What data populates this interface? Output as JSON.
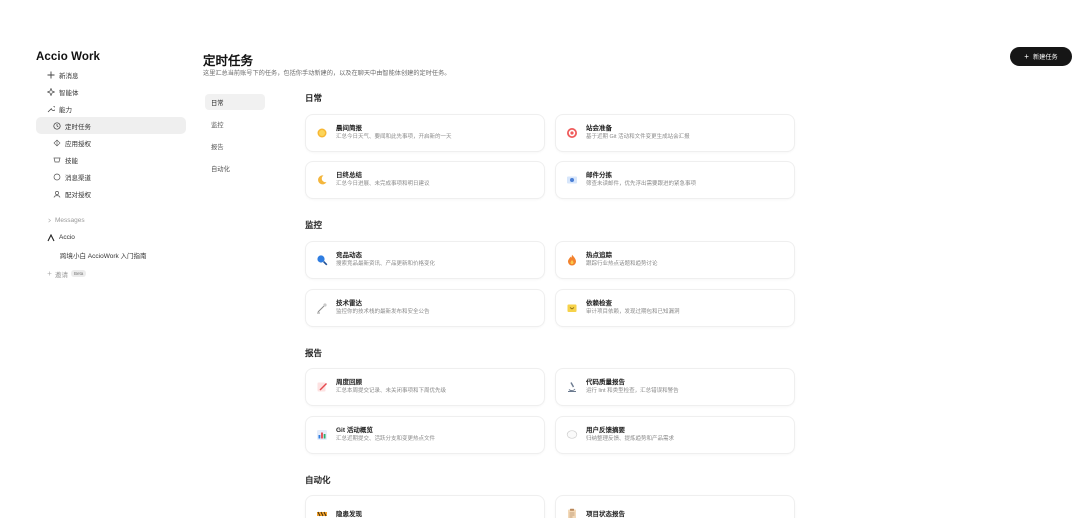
{
  "sidebar": {
    "brand": "Accio Work",
    "items": [
      {
        "label": "新消息",
        "icon": "plus-icon"
      },
      {
        "label": "智能体",
        "icon": "sparkle-icon"
      },
      {
        "label": "能力",
        "icon": "wrench-icon"
      }
    ],
    "sub_items": [
      {
        "label": "定时任务",
        "icon": "clock-icon",
        "active": true
      },
      {
        "label": "应用授权",
        "icon": "link-icon"
      },
      {
        "label": "技能",
        "icon": "skill-icon"
      },
      {
        "label": "消息渠道",
        "icon": "channel-icon"
      },
      {
        "label": "配对授权",
        "icon": "pair-icon"
      }
    ],
    "messages_label": "Messages",
    "accio_label": "Accio",
    "conversation": "跨境小白 AccioWork 入门指南",
    "invite_label": "邀请",
    "beta": "Beta"
  },
  "header": {
    "title": "定时任务",
    "subtitle": "这里汇总当前账号下的任务，包括你手动新建的，以及在聊天中由智能体创建的定时任务。",
    "new_task": "新建任务"
  },
  "categories": [
    "日常",
    "监控",
    "报告",
    "自动化"
  ],
  "sections": {
    "daily": {
      "title": "日常",
      "cards": [
        {
          "title": "晨间简报",
          "desc": "汇总今日天气、要闻和此先事项，开启新的一天",
          "icon": "sun-icon"
        },
        {
          "title": "站会准备",
          "desc": "基于近期 Git 活动和文件变更生成站会汇报",
          "icon": "target-icon"
        },
        {
          "title": "日终总结",
          "desc": "汇总今日进展、未完成事项和明日建议",
          "icon": "moon-icon"
        },
        {
          "title": "邮件分拣",
          "desc": "筛查未读邮件，优先浮出需要跟进的紧急事项",
          "icon": "mail-icon"
        }
      ]
    },
    "monitor": {
      "title": "监控",
      "cards": [
        {
          "title": "竞品动态",
          "desc": "搜索竞品最新资讯、产品更新和价格变化",
          "icon": "magnifier-icon"
        },
        {
          "title": "热点追踪",
          "desc": "跟踪行业热点话题和趋势讨论",
          "icon": "flame-icon"
        },
        {
          "title": "技术雷达",
          "desc": "监控你的技术栈的最新发布和安全公告",
          "icon": "radar-icon"
        },
        {
          "title": "依赖检查",
          "desc": "审计项目依赖，发现过期包和已知漏洞",
          "icon": "package-icon"
        }
      ]
    },
    "report": {
      "title": "报告",
      "cards": [
        {
          "title": "周度回顾",
          "desc": "汇总本周提交记录、未关闭事项和下周优先级",
          "icon": "pencil-icon"
        },
        {
          "title": "代码质量报告",
          "desc": "运行 lint 和类型检查，汇总错误和警告",
          "icon": "microscope-icon"
        },
        {
          "title": "Git 活动概览",
          "desc": "汇总近期提交、活跃分支和变更热点文件",
          "icon": "bar-chart-icon"
        },
        {
          "title": "用户反馈摘要",
          "desc": "归纳整理反馈、提炼趋势和产品需求",
          "icon": "bubble-icon"
        }
      ]
    },
    "automation": {
      "title": "自动化",
      "cards": [
        {
          "title": "隐患发现",
          "desc": "",
          "icon": "hazard-icon"
        },
        {
          "title": "项目状态报告",
          "desc": "",
          "icon": "clipboard-icon"
        }
      ]
    }
  },
  "colors": {
    "primary_button": "#161616",
    "active_bg": "#efefef"
  }
}
